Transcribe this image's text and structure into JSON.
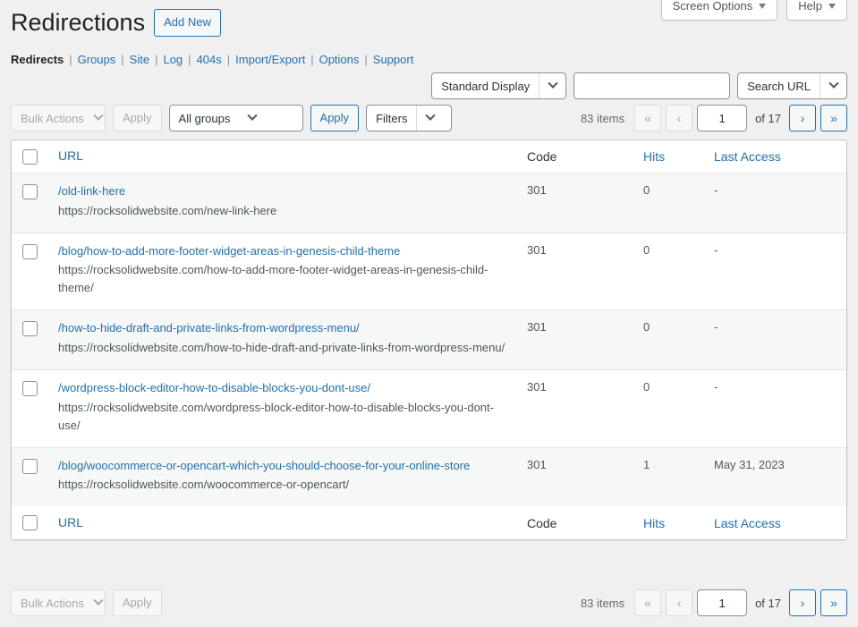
{
  "header": {
    "title": "Redirections",
    "add_new_label": "Add New",
    "screen_options_label": "Screen Options",
    "help_label": "Help"
  },
  "subnav": [
    {
      "label": "Redirects",
      "current": true
    },
    {
      "label": "Groups",
      "current": false
    },
    {
      "label": "Site",
      "current": false
    },
    {
      "label": "Log",
      "current": false
    },
    {
      "label": "404s",
      "current": false
    },
    {
      "label": "Import/Export",
      "current": false
    },
    {
      "label": "Options",
      "current": false
    },
    {
      "label": "Support",
      "current": false
    }
  ],
  "search": {
    "display_mode": "Standard Display",
    "query_value": "",
    "query_placeholder": "",
    "search_scope": "Search URL"
  },
  "toolbar": {
    "bulk_actions_label": "Bulk Actions",
    "apply_label": "Apply",
    "group_filter_label": "All groups",
    "group_apply_label": "Apply",
    "filters_label": "Filters"
  },
  "pagination": {
    "items_text": "83 items",
    "first_label": "«",
    "prev_label": "‹",
    "current_page": "1",
    "of_text": "of 17",
    "next_label": "›",
    "last_label": "»"
  },
  "table": {
    "columns": {
      "url": "URL",
      "code": "Code",
      "hits": "Hits",
      "last_access": "Last Access"
    },
    "rows": [
      {
        "source": "/old-link-here",
        "target": "https://rocksolidwebsite.com/new-link-here",
        "code": "301",
        "hits": "0",
        "last_access": "-"
      },
      {
        "source": "/blog/how-to-add-more-footer-widget-areas-in-genesis-child-theme",
        "target": "https://rocksolidwebsite.com/how-to-add-more-footer-widget-areas-in-genesis-child-theme/",
        "code": "301",
        "hits": "0",
        "last_access": "-"
      },
      {
        "source": "/how-to-hide-draft-and-private-links-from-wordpress-menu/",
        "target": "https://rocksolidwebsite.com/how-to-hide-draft-and-private-links-from-wordpress-menu/",
        "code": "301",
        "hits": "0",
        "last_access": "-"
      },
      {
        "source": "/wordpress-block-editor-how-to-disable-blocks-you-dont-use/",
        "target": "https://rocksolidwebsite.com/wordpress-block-editor-how-to-disable-blocks-you-dont-use/",
        "code": "301",
        "hits": "0",
        "last_access": "-"
      },
      {
        "source": "/blog/woocommerce-or-opencart-which-you-should-choose-for-your-online-store",
        "target": "https://rocksolidwebsite.com/woocommerce-or-opencart/",
        "code": "301",
        "hits": "1",
        "last_access": "May 31, 2023"
      }
    ]
  },
  "colors": {
    "link": "#2271b1",
    "page_bg": "#f0f0f1",
    "row_alt_bg": "#f6f7f7",
    "text": "#3c434a"
  }
}
